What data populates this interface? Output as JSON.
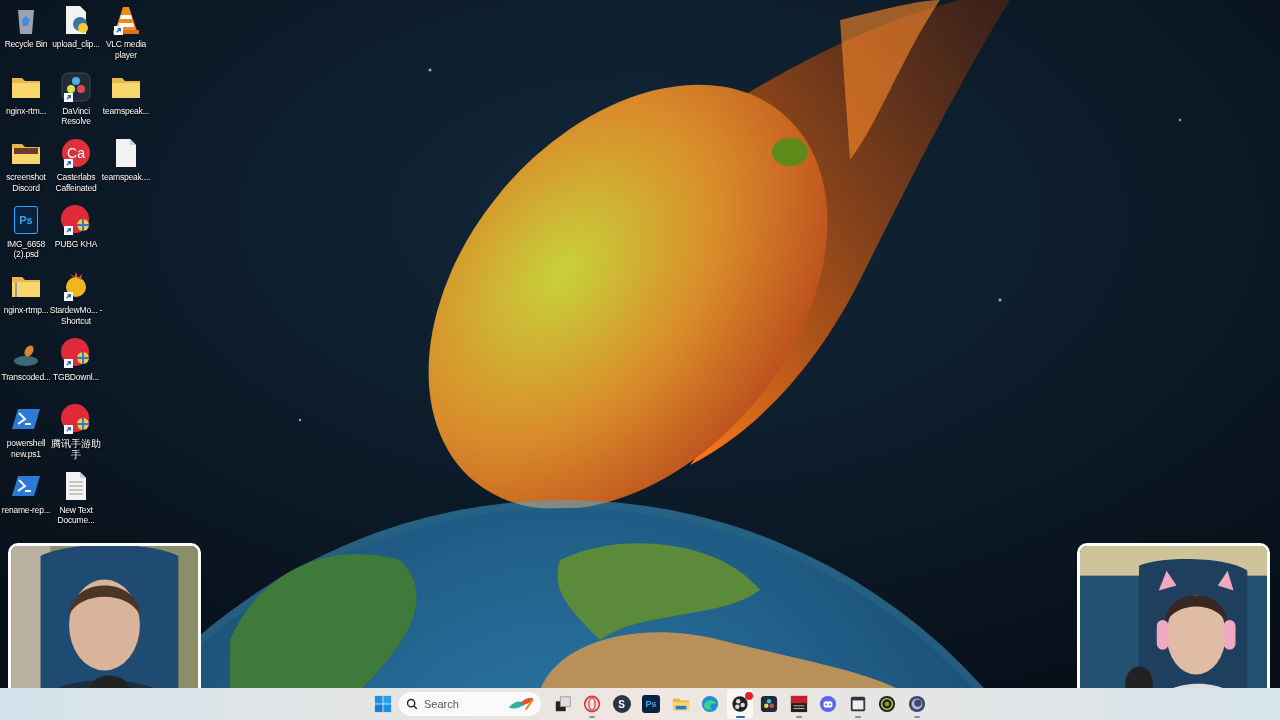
{
  "desktop_icons": [
    {
      "label": "Recycle Bin",
      "kind": "recycle",
      "shortcut": false
    },
    {
      "label": "nginx-rtm...",
      "kind": "folder",
      "shortcut": false
    },
    {
      "label": "screenshot Discord",
      "kind": "folder-photo",
      "shortcut": false
    },
    {
      "label": "IMG_6658 (2).psd",
      "kind": "psd",
      "shortcut": false,
      "icon_text": "Ps"
    },
    {
      "label": "nginx-rtmp...",
      "kind": "zip-folder",
      "shortcut": false
    },
    {
      "label": "Transcoded...",
      "kind": "planet",
      "shortcut": false
    },
    {
      "label": "powershell new.ps1",
      "kind": "powershell",
      "shortcut": false
    },
    {
      "label": "rename-rep...",
      "kind": "powershell",
      "shortcut": false
    },
    {
      "label": "upload_clip...",
      "kind": "python",
      "shortcut": false
    },
    {
      "label": "DaVinci Resolve",
      "kind": "davinci",
      "shortcut": true
    },
    {
      "label": "Casterlabs Caffeinated",
      "kind": "casterlabs",
      "shortcut": true,
      "icon_text": "Ca"
    },
    {
      "label": "PUBG KHA",
      "kind": "red-bird",
      "shortcut": true
    },
    {
      "label": "StardewMo... - Shortcut",
      "kind": "sun",
      "shortcut": true
    },
    {
      "label": "TGBDownl...",
      "kind": "red-bird",
      "shortcut": true
    },
    {
      "label": "腾讯手游助手",
      "kind": "red-bird",
      "shortcut": true
    },
    {
      "label": "New Text Docume...",
      "kind": "text-file",
      "shortcut": false
    },
    {
      "label": "VLC media player",
      "kind": "cone",
      "shortcut": true
    },
    {
      "label": "teamspeak...",
      "kind": "folder",
      "shortcut": false
    },
    {
      "label": "teamspeak....",
      "kind": "blank-file",
      "shortcut": false
    }
  ],
  "taskbar": {
    "search": {
      "placeholder": "Search"
    },
    "apps": [
      {
        "kind": "task-view",
        "running": false,
        "active": false,
        "notification": false
      },
      {
        "kind": "opera",
        "running": true,
        "active": false,
        "notification": false
      },
      {
        "kind": "s-app",
        "running": false,
        "active": false,
        "notification": false,
        "icon_text": "S"
      },
      {
        "kind": "photoshop",
        "running": false,
        "active": false,
        "notification": false,
        "icon_text": "Ps"
      },
      {
        "kind": "file-explorer",
        "running": false,
        "active": false,
        "notification": false
      },
      {
        "kind": "edge",
        "running": false,
        "active": false,
        "notification": false
      },
      {
        "kind": "obs",
        "running": true,
        "active": true,
        "notification": true
      },
      {
        "kind": "davinci",
        "running": false,
        "active": false,
        "notification": false
      },
      {
        "kind": "mixer",
        "running": true,
        "active": false,
        "notification": false
      },
      {
        "kind": "discord",
        "running": false,
        "active": false,
        "notification": false
      },
      {
        "kind": "window-app",
        "running": true,
        "active": false,
        "notification": false
      },
      {
        "kind": "green-lens",
        "running": false,
        "active": false,
        "notification": false
      },
      {
        "kind": "blue-ring",
        "running": true,
        "active": false,
        "notification": false
      }
    ]
  }
}
